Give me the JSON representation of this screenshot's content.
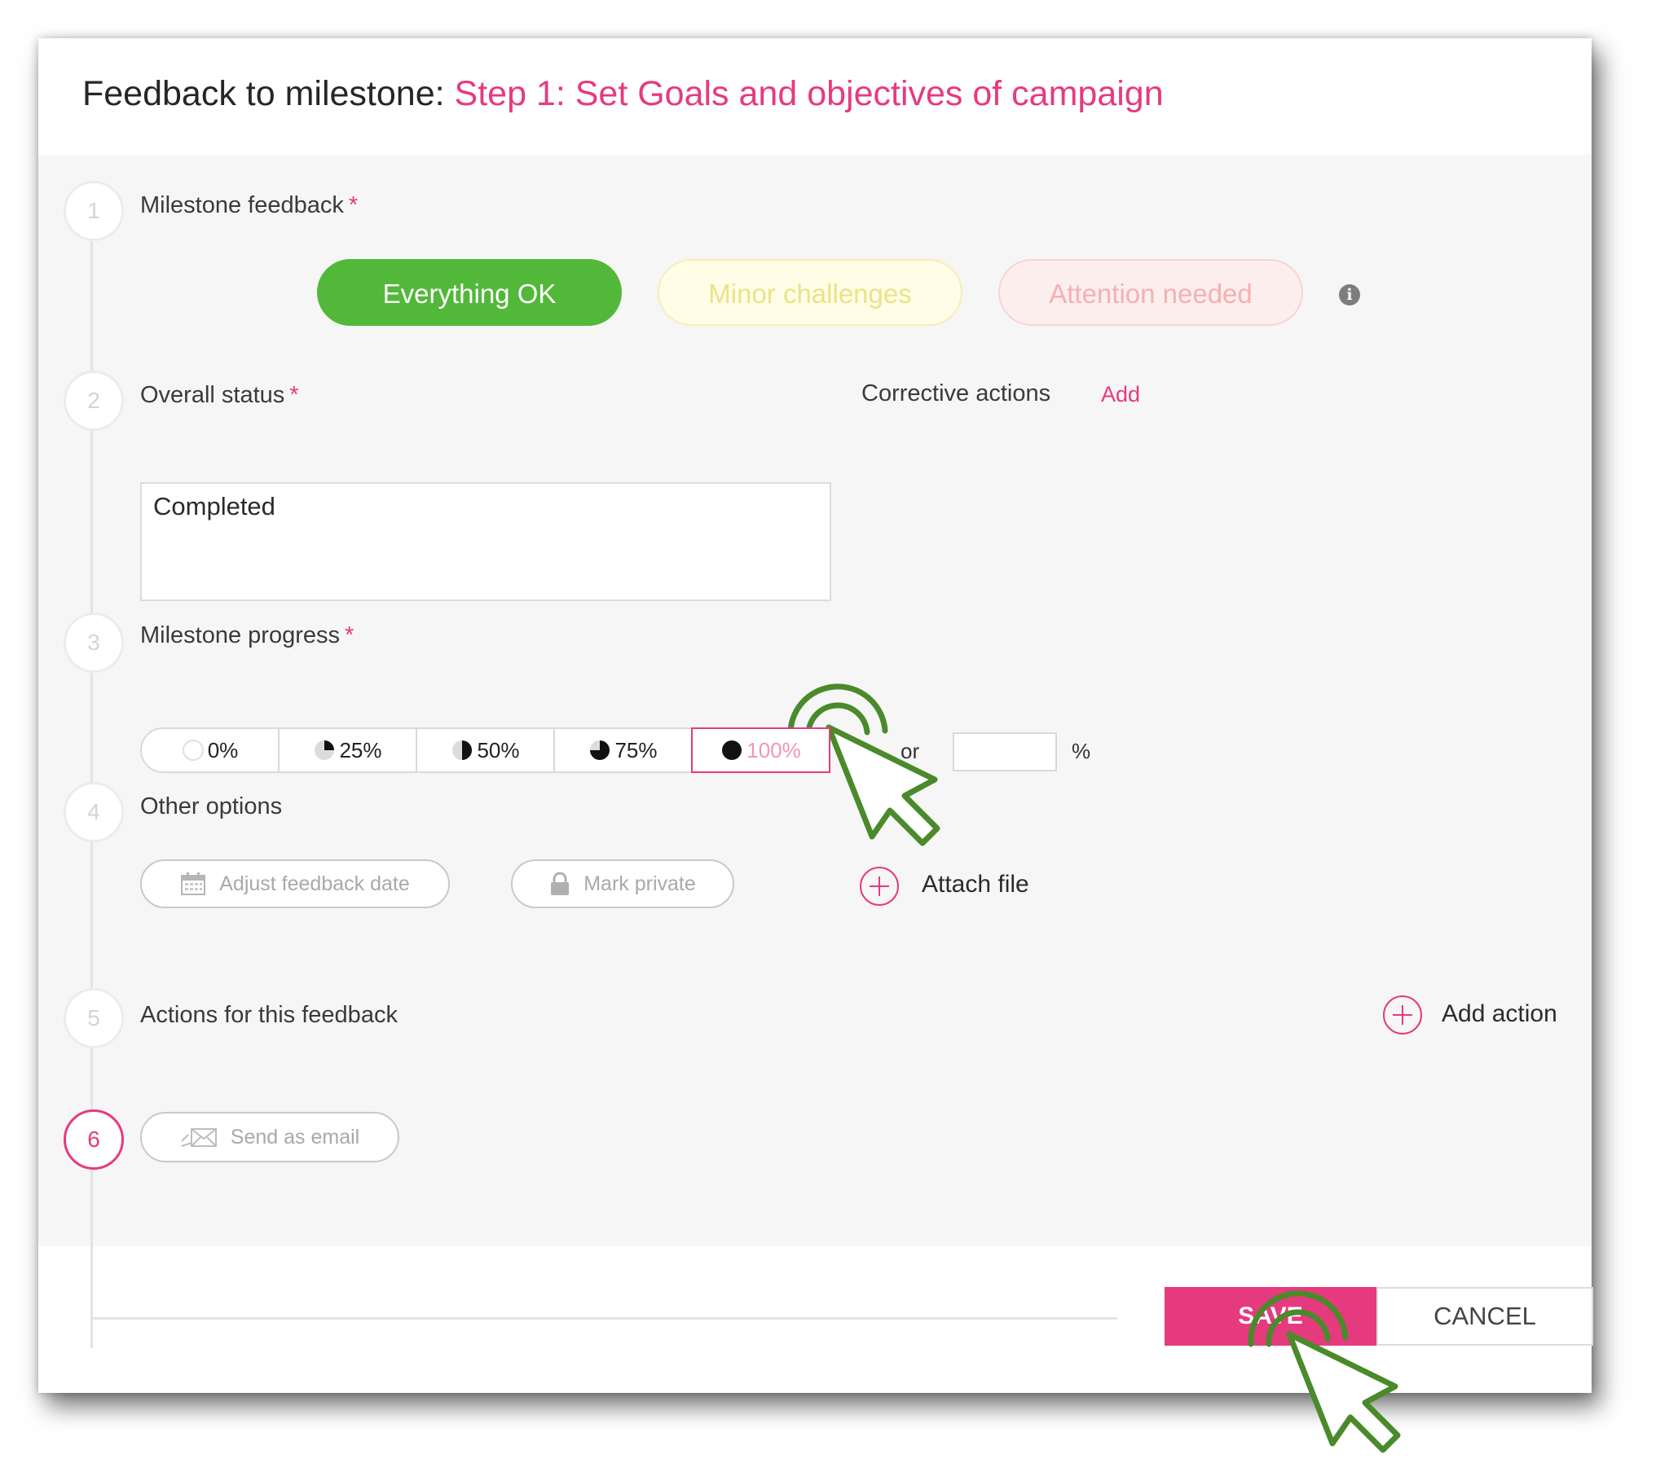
{
  "dialog": {
    "title_prefix": "Feedback to milestone:",
    "title_milestone": "Step 1: Set Goals and objectives of campaign"
  },
  "steps": [
    {
      "number": "1",
      "label": "Milestone feedback",
      "required": "*"
    },
    {
      "number": "2",
      "label": "Overall status",
      "required": "*"
    },
    {
      "number": "3",
      "label": "Milestone progress",
      "required": "*"
    },
    {
      "number": "4",
      "label": "Other options"
    },
    {
      "number": "5",
      "label": "Actions for this feedback"
    },
    {
      "number": "6"
    }
  ],
  "feedback_options": {
    "ok": "Everything OK",
    "minor": "Minor challenges",
    "attention": "Attention needed",
    "selected": "ok"
  },
  "overall_status": {
    "value": "Completed"
  },
  "corrective_actions": {
    "label": "Corrective actions",
    "add_link": "Add"
  },
  "progress": {
    "options": [
      "0%",
      "25%",
      "50%",
      "75%",
      "100%"
    ],
    "selected": "100%",
    "or_label": "or",
    "custom_value": "",
    "unit": "%"
  },
  "other_options": {
    "adjust_date": "Adjust feedback date",
    "mark_private": "Mark private",
    "attach_file": "Attach file"
  },
  "actions": {
    "add_action": "Add action"
  },
  "email": {
    "send_as_email": "Send as email"
  },
  "footer": {
    "save": "SAVE",
    "cancel": "CANCEL"
  },
  "colors": {
    "accent": "#e63a7f",
    "ok_green": "#52b83a",
    "cursor_green": "#4a8a2a"
  }
}
